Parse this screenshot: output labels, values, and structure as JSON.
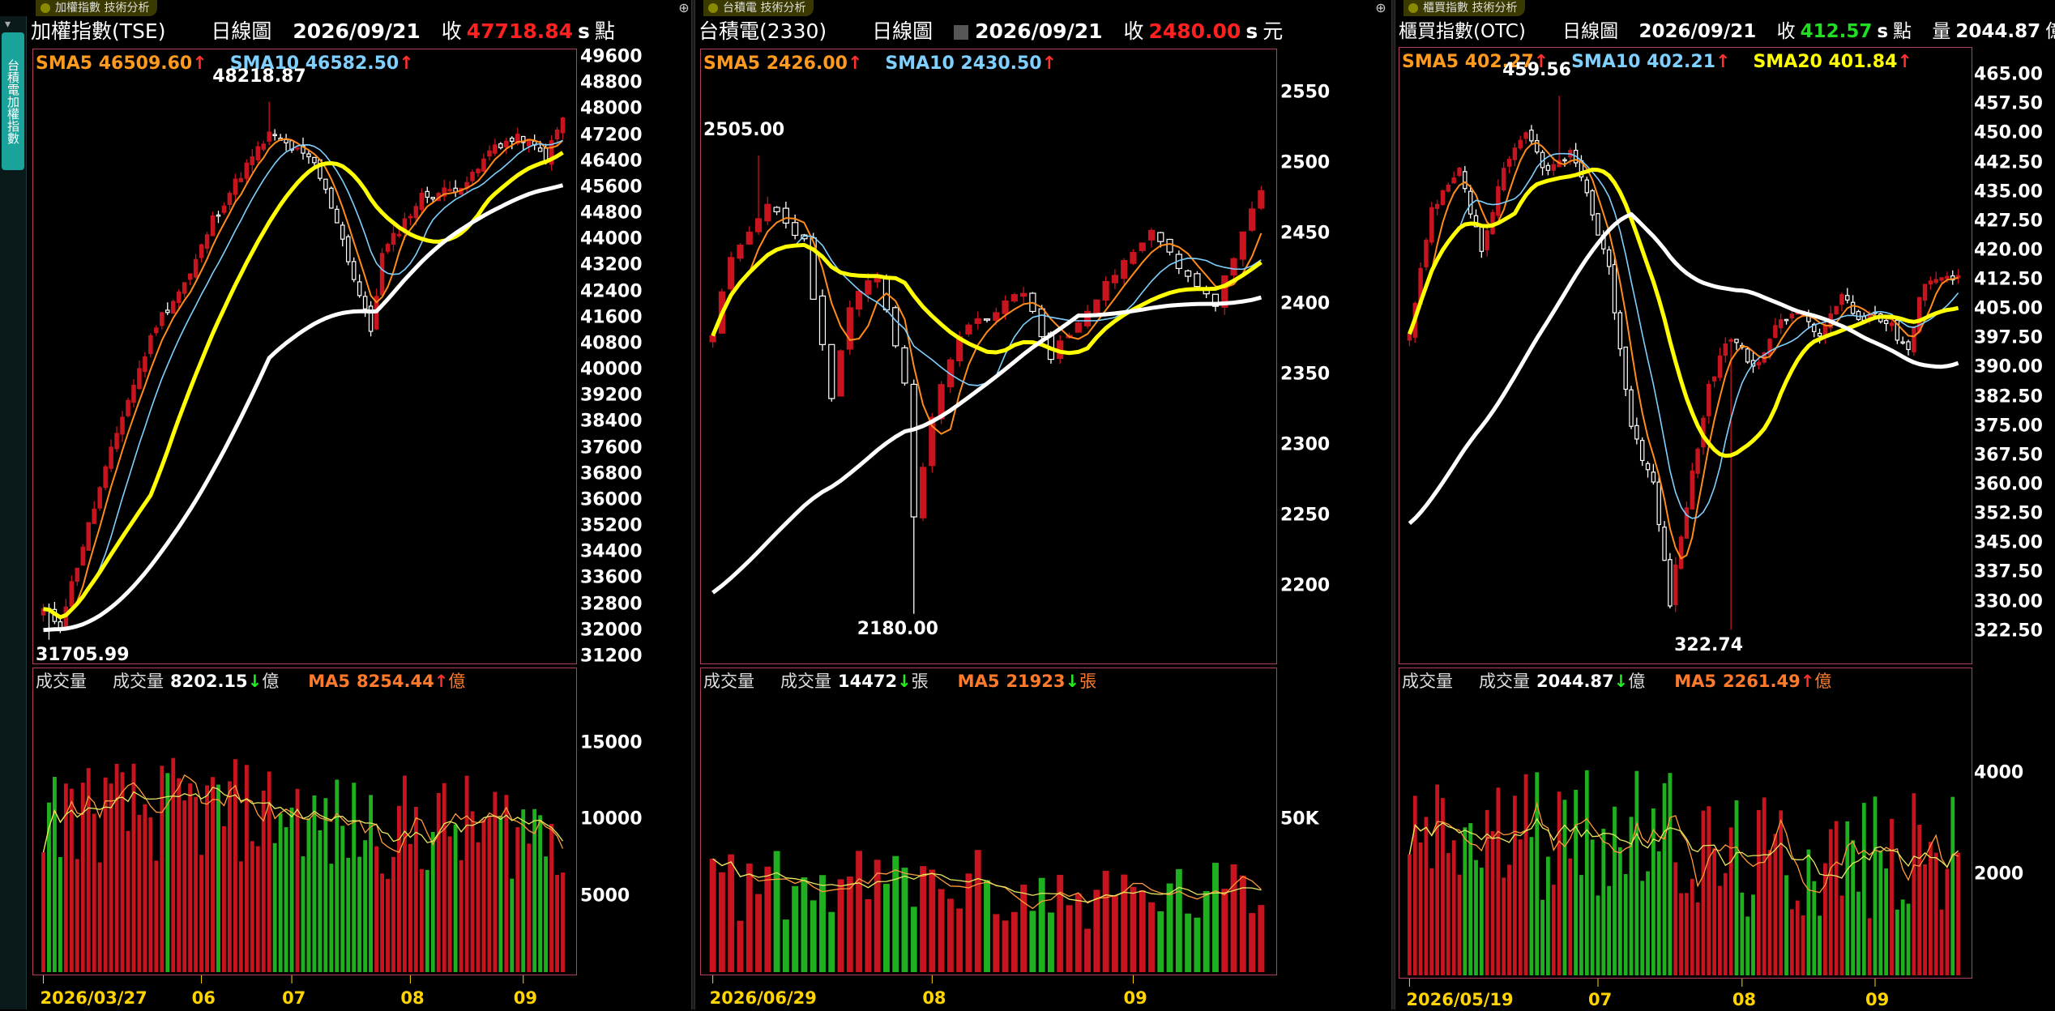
{
  "sidebar": {
    "tab_label": "台積電加權指數"
  },
  "colors": {
    "up": "#c8141e",
    "down": "#1fb020",
    "sma5": "#ff8c1a",
    "sma10": "#7fd0ff",
    "sma20": "#ffff00",
    "long": "#ffffff",
    "vol_ma5": "#ff9a3c",
    "vol_ma10": "#e8e860",
    "axis_date": "#ffd400",
    "frame": "#b04060"
  },
  "panels": [
    {
      "tab_title": "加權指數 技術分析",
      "header": {
        "name": "加權指數(TSE)",
        "period": "日線圖",
        "date": "2026/09/21",
        "close_label": "收",
        "close": "47718.84",
        "close_suffix": "s",
        "unit": "點"
      },
      "legend": [
        {
          "label": "SMA5",
          "value": "46509.60",
          "arrow": "↑",
          "color": "#ff9a20"
        },
        {
          "label": "SMA10",
          "value": "46582.50",
          "arrow": "↑",
          "color": "#7fd0ff"
        }
      ],
      "volume_legend": {
        "title": "成交量",
        "label": "成交量",
        "value": "8202.15",
        "arrow": "↓",
        "unit": "億",
        "ma_label": "MA5",
        "ma_value": "8254.44",
        "ma_arrow": "↑",
        "ma_unit": "億"
      },
      "annotations": {
        "high": "48218.87",
        "low": "31705.99"
      },
      "x_labels": [
        "2026/03/27",
        "06",
        "07",
        "08",
        "09"
      ],
      "chart_data": {
        "type": "candlestick",
        "ylim": [
          31200,
          49600
        ],
        "y_ticks": [
          "49600",
          "48800",
          "48000",
          "47200",
          "46400",
          "45600",
          "44800",
          "44000",
          "43200",
          "42400",
          "41600",
          "40800",
          "40000",
          "39200",
          "38400",
          "37600",
          "36800",
          "36000",
          "35200",
          "34400",
          "33600",
          "32800",
          "32000",
          "31200"
        ],
        "volume_ylim": [
          0,
          18000
        ],
        "volume_ticks": [
          "15000",
          "10000",
          "5000"
        ],
        "volume_tick_values": [
          15000,
          10000,
          5000
        ],
        "x_tick_index": [
          0,
          28,
          44,
          65,
          85
        ],
        "anchors": [
          [
            0,
            32600
          ],
          [
            3,
            32200
          ],
          [
            8,
            35200
          ],
          [
            14,
            38600
          ],
          [
            20,
            41400
          ],
          [
            26,
            42900
          ],
          [
            30,
            44600
          ],
          [
            35,
            46000
          ],
          [
            40,
            47200
          ],
          [
            44,
            46800
          ],
          [
            48,
            46300
          ],
          [
            52,
            44600
          ],
          [
            55,
            42800
          ],
          [
            58,
            41200
          ],
          [
            60,
            43500
          ],
          [
            63,
            44300
          ],
          [
            67,
            45300
          ],
          [
            72,
            45500
          ],
          [
            76,
            45900
          ],
          [
            80,
            46900
          ],
          [
            85,
            47100
          ],
          [
            89,
            46500
          ],
          [
            92,
            47718.84
          ]
        ],
        "high": 48218.87,
        "low": 31705.99,
        "high_index": 40,
        "low_index": 1,
        "n": 93,
        "seed": 11,
        "vol_base": 9500,
        "vol_amp": 3500,
        "long_start": 32000
      }
    },
    {
      "tab_title": "台積電 技術分析",
      "header": {
        "name": "台積電(2330)",
        "period": "日線圖",
        "date": "2026/09/21",
        "close_label": "收",
        "close": "2480.00",
        "close_suffix": "s",
        "unit": "元"
      },
      "legend": [
        {
          "label": "SMA5",
          "value": "2426.00",
          "arrow": "↑",
          "color": "#ff9a20"
        },
        {
          "label": "SMA10",
          "value": "2430.50",
          "arrow": "↑",
          "color": "#7fd0ff"
        }
      ],
      "volume_legend": {
        "title": "成交量",
        "label": "成交量",
        "value": "14472",
        "arrow": "↓",
        "unit": "張",
        "ma_label": "MA5",
        "ma_value": "21923",
        "ma_arrow": "↓",
        "ma_unit": "張"
      },
      "annotations": {
        "high": "2505.00",
        "low": "2180.00"
      },
      "x_labels": [
        "2026/06/29",
        "08",
        "09"
      ],
      "chart_data": {
        "type": "candlestick",
        "ylim": [
          2150,
          2575
        ],
        "y_ticks": [
          "2550",
          "2500",
          "2450",
          "2400",
          "2350",
          "2300",
          "2250",
          "2200"
        ],
        "volume_ylim": [
          0,
          90000
        ],
        "volume_ticks": [
          "50K"
        ],
        "volume_tick_values": [
          50000
        ],
        "x_tick_index": [
          0,
          24,
          46
        ],
        "anchors": [
          [
            0,
            2380
          ],
          [
            2,
            2430
          ],
          [
            6,
            2470
          ],
          [
            10,
            2445
          ],
          [
            13,
            2330
          ],
          [
            15,
            2400
          ],
          [
            18,
            2420
          ],
          [
            21,
            2340
          ],
          [
            22,
            2250
          ],
          [
            24,
            2320
          ],
          [
            27,
            2380
          ],
          [
            30,
            2390
          ],
          [
            34,
            2410
          ],
          [
            37,
            2360
          ],
          [
            40,
            2390
          ],
          [
            44,
            2420
          ],
          [
            48,
            2450
          ],
          [
            52,
            2420
          ],
          [
            55,
            2400
          ],
          [
            58,
            2450
          ],
          [
            60,
            2480
          ]
        ],
        "high": 2505.0,
        "low": 2180.0,
        "high_index": 5,
        "low_index": 22,
        "n": 61,
        "seed": 23,
        "vol_base": 25000,
        "vol_amp": 12000,
        "long_start": 2195
      }
    },
    {
      "tab_title": "櫃買指數 技術分析",
      "header": {
        "name": "櫃買指數(OTC)",
        "period": "日線圖",
        "date": "2026/09/21",
        "close_label": "收",
        "close": "412.57",
        "close_suffix": "s",
        "unit": "點",
        "vol_label": "量",
        "vol_value": "2044.87",
        "vol_unit": "億"
      },
      "legend": [
        {
          "label": "SMA5",
          "value": "402.27",
          "arrow": "↑",
          "color": "#ff9a20"
        },
        {
          "label": "SMA10",
          "value": "402.21",
          "arrow": "↑",
          "color": "#7fd0ff"
        },
        {
          "label": "SMA20",
          "value": "401.84",
          "arrow": "↑",
          "color": "#ffff00"
        }
      ],
      "volume_legend": {
        "title": "成交量",
        "label": "成交量",
        "value": "2044.87",
        "arrow": "↓",
        "unit": "億",
        "ma_label": "MA5",
        "ma_value": "2261.49",
        "ma_arrow": "↑",
        "ma_unit": "億"
      },
      "annotations": {
        "high": "459.56",
        "low": "322.74"
      },
      "x_labels": [
        "2026/05/19",
        "07",
        "08",
        "09"
      ],
      "chart_data": {
        "type": "candlestick",
        "ylim": [
          316,
          470
        ],
        "y_ticks": [
          "465.00",
          "457.50",
          "450.00",
          "442.50",
          "435.00",
          "427.50",
          "420.00",
          "412.50",
          "405.00",
          "397.50",
          "390.00",
          "382.50",
          "375.00",
          "367.50",
          "360.00",
          "352.50",
          "345.00",
          "337.50",
          "330.00",
          "322.50"
        ],
        "volume_ylim": [
          0,
          5500
        ],
        "volume_ticks": [
          "4000",
          "2000"
        ],
        "volume_tick_values": [
          4000,
          2000
        ],
        "x_tick_index": [
          0,
          34,
          60,
          84
        ],
        "anchors": [
          [
            0,
            398
          ],
          [
            4,
            430
          ],
          [
            9,
            440
          ],
          [
            13,
            420
          ],
          [
            17,
            440
          ],
          [
            21,
            450
          ],
          [
            25,
            440
          ],
          [
            29,
            445
          ],
          [
            33,
            430
          ],
          [
            36,
            415
          ],
          [
            40,
            375
          ],
          [
            44,
            360
          ],
          [
            47,
            330
          ],
          [
            50,
            355
          ],
          [
            54,
            385
          ],
          [
            58,
            398
          ],
          [
            62,
            390
          ],
          [
            66,
            400
          ],
          [
            70,
            405
          ],
          [
            74,
            398
          ],
          [
            78,
            408
          ],
          [
            81,
            402
          ],
          [
            84,
            404
          ],
          [
            87,
            400
          ],
          [
            90,
            395
          ],
          [
            93,
            412.57
          ]
        ],
        "high": 459.56,
        "low": 322.74,
        "high_index": 27,
        "low_index": 58,
        "n": 100,
        "seed": 37,
        "vol_base": 2400,
        "vol_amp": 1300,
        "long_start": 350
      }
    }
  ]
}
